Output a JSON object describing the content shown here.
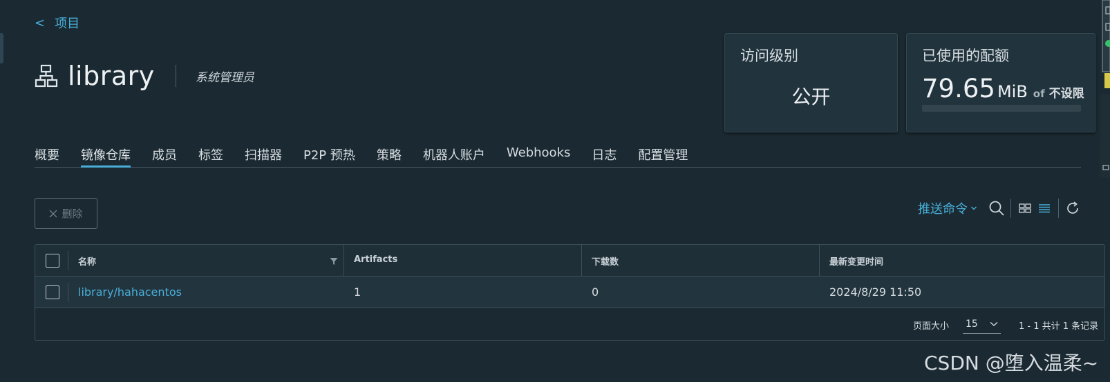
{
  "nav": {
    "back_label": "项目"
  },
  "project": {
    "name": "library",
    "role": "系统管理员"
  },
  "cards": {
    "access": {
      "title": "访问级别",
      "value": "公开"
    },
    "quota": {
      "title": "已使用的配额",
      "used_value": "79.65",
      "used_unit": "MiB",
      "of_label": "of",
      "limit": "不设限"
    }
  },
  "tabs": [
    {
      "label": "概要",
      "active": false
    },
    {
      "label": "镜像仓库",
      "active": true
    },
    {
      "label": "成员",
      "active": false
    },
    {
      "label": "标签",
      "active": false
    },
    {
      "label": "扫描器",
      "active": false
    },
    {
      "label": "P2P 预热",
      "active": false
    },
    {
      "label": "策略",
      "active": false
    },
    {
      "label": "机器人账户",
      "active": false
    },
    {
      "label": "Webhooks",
      "active": false
    },
    {
      "label": "日志",
      "active": false
    },
    {
      "label": "配置管理",
      "active": false
    }
  ],
  "toolbar": {
    "delete_label": "删除",
    "push_command_label": "推送命令"
  },
  "table": {
    "columns": [
      "名称",
      "Artifacts",
      "下载数",
      "最新变更时间"
    ],
    "rows": [
      {
        "name": "library/hahacentos",
        "artifacts": "1",
        "pulls": "0",
        "updated": "2024/8/29 11:50"
      }
    ]
  },
  "pagination": {
    "page_size_label": "页面大小",
    "page_size": "15",
    "summary": "1 - 1 共计 1 条记录"
  },
  "watermark": "CSDN @堕入温柔~",
  "colors": {
    "accent": "#49afd9",
    "background": "#1b2a32",
    "card": "#21333d"
  }
}
